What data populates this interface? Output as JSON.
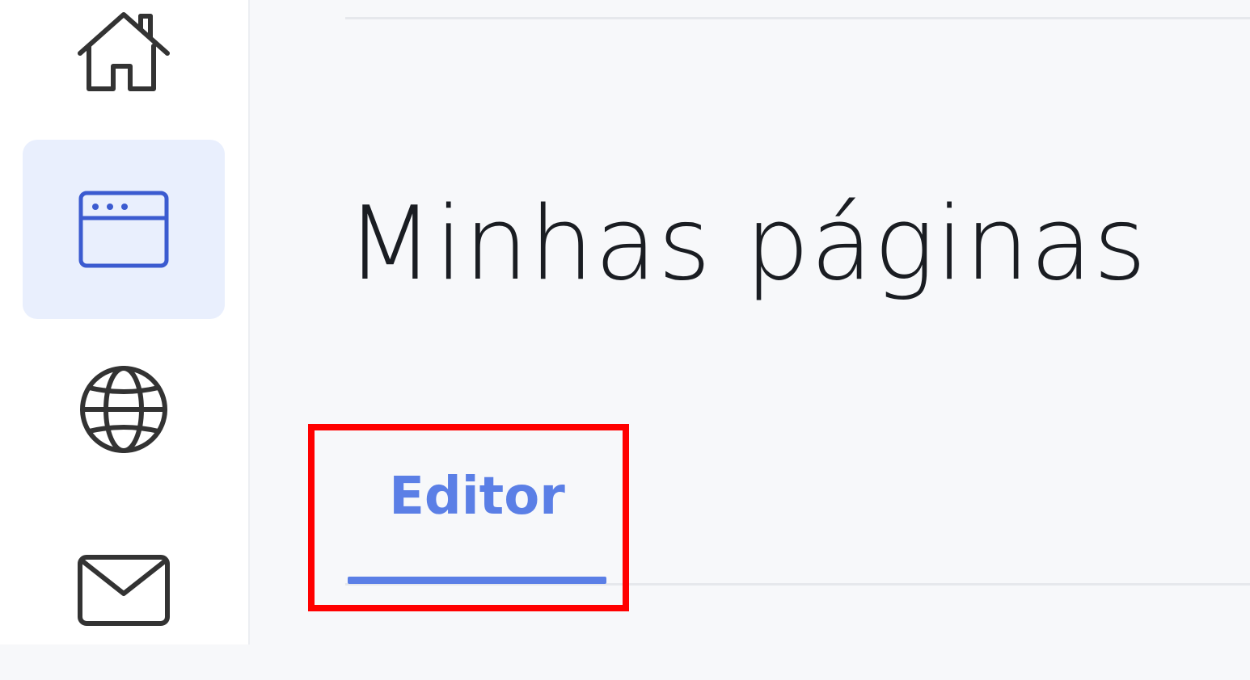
{
  "sidebar": {
    "items": [
      {
        "icon": "home-icon",
        "active": false
      },
      {
        "icon": "browser-window-icon",
        "active": true
      },
      {
        "icon": "globe-icon",
        "active": false
      },
      {
        "icon": "mail-icon",
        "active": false
      }
    ]
  },
  "main": {
    "title": "Minhas páginas",
    "tabs": [
      {
        "label": "Editor",
        "active": true
      }
    ]
  },
  "colors": {
    "accent": "#5b7fe6",
    "active_nav_bg": "#e9effd",
    "icon_default": "#333333",
    "icon_active": "#3b5bd0",
    "highlight": "#ff0000"
  }
}
